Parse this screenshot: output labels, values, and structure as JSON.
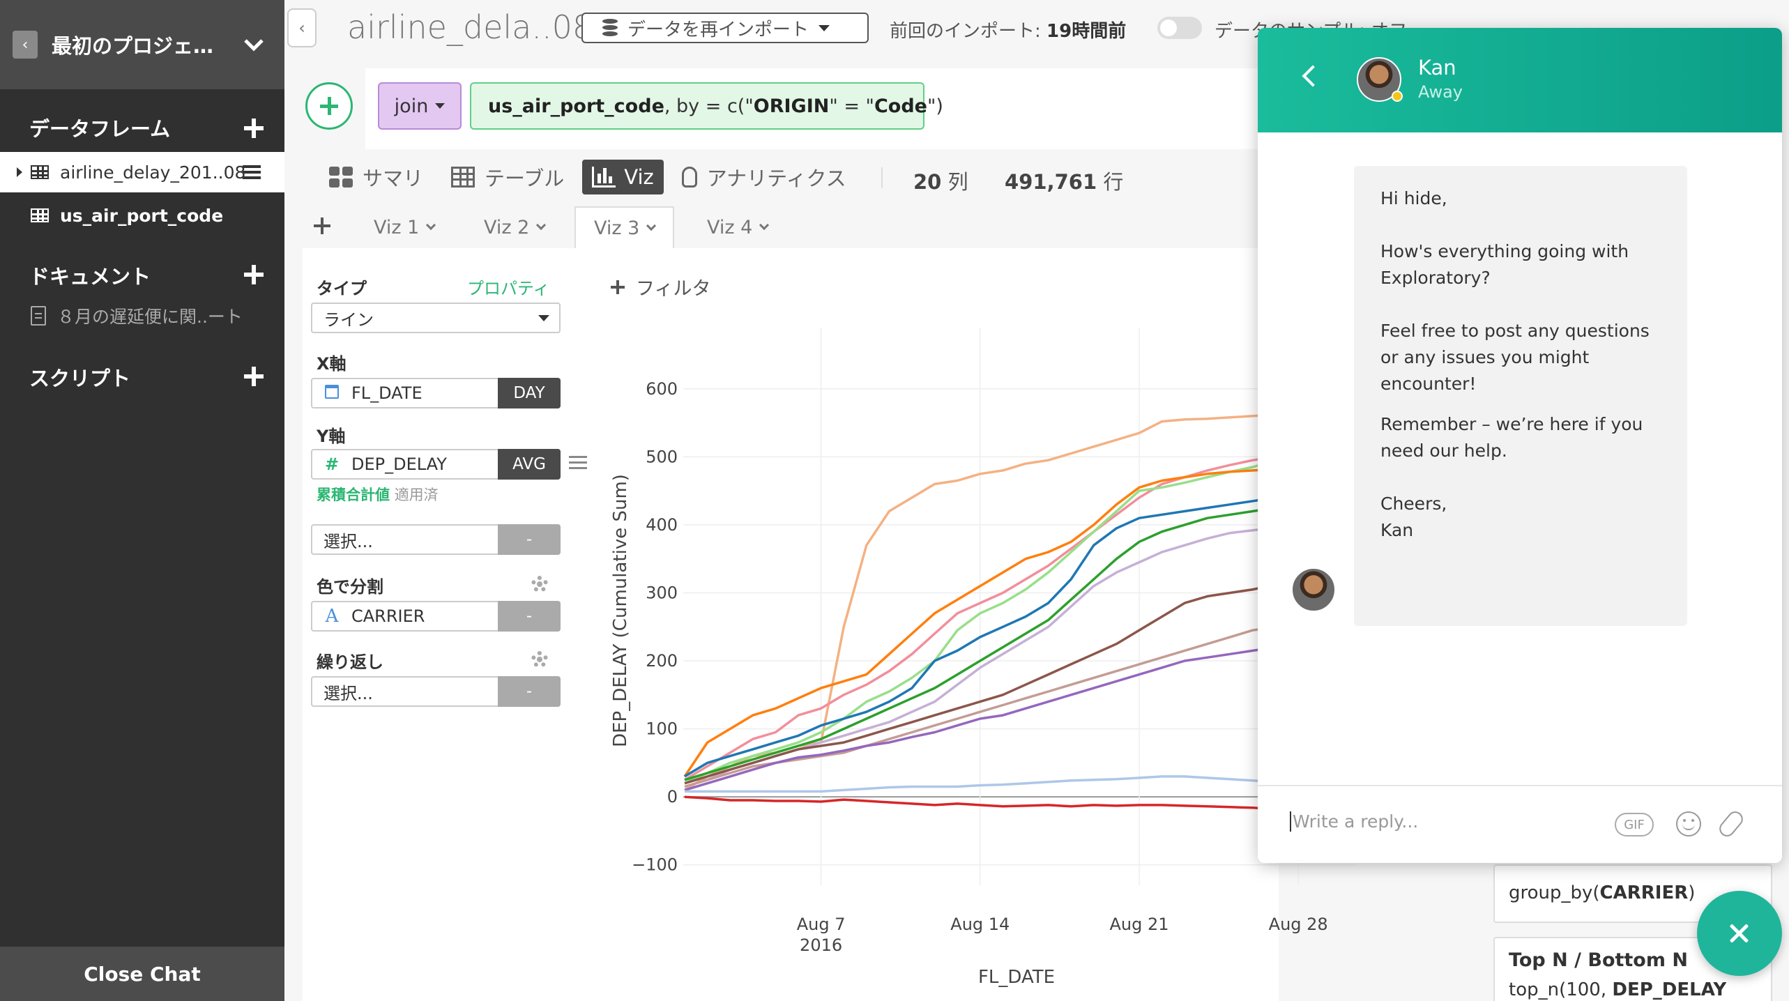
{
  "sidebar": {
    "project_title": "最初のプロジェ…",
    "sections": {
      "dataframes": "データフレーム",
      "documents": "ドキュメント",
      "scripts": "スクリプト"
    },
    "dataframes": [
      "airline_delay_201..08",
      "us_air_port_code"
    ],
    "documents": [
      "８月の遅延便に関..ート"
    ],
    "close_chat": "Close Chat"
  },
  "topbar": {
    "dataframe_name": "airline_dela..08",
    "reimport_label": "データを再インポート",
    "last_import_label": "前回のインポート: ",
    "last_import_value": "19時間前",
    "sample_label": "データのサンプル: オフ"
  },
  "pipeline": {
    "command": "join",
    "args_prefix": "us_air_port_code",
    "args_mid": ", by = c(\"",
    "args_key1": "ORIGIN",
    "args_eq": "\" = \"",
    "args_key2": "Code",
    "args_end": "\")"
  },
  "view_tabs": {
    "summary": "サマリ",
    "table": "テーブル",
    "viz": "Viz",
    "analytics": "アナリティクス"
  },
  "stats": {
    "columns": "20",
    "columns_unit": "列",
    "rows": "491,761",
    "rows_unit": "行"
  },
  "viz_tabs": [
    "Viz 1",
    "Viz 2",
    "Viz 3",
    "Viz 4"
  ],
  "config": {
    "type_label": "タイプ",
    "property_link": "プロパティ",
    "type_value": "ライン",
    "x_label": "X軸",
    "x_field": "FL_DATE",
    "x_agg": "DAY",
    "y_label": "Y軸",
    "y_field": "DEP_DELAY",
    "y_agg": "AVG",
    "cumulative_label": "累積合計値",
    "cumulative_status": "適用済",
    "select_placeholder": "選択...",
    "dash": "-",
    "color_label": "色で分割",
    "color_field": "CARRIER",
    "repeat_label": "繰り返し",
    "repeat_placeholder": "選択...",
    "filter_label": "フィルタ"
  },
  "side_cards": {
    "group_by_prefix": "group_by(",
    "group_by_field": "CARRIER",
    "group_by_suffix": ")",
    "topn_title": "Top N / Bottom N",
    "topn_code_prefix": "top_n(100, ",
    "topn_code_field": "DEP_DELAY"
  },
  "chat": {
    "agent_name": "Kan",
    "agent_status": "Away",
    "messages": [
      "Hi hide,",
      "How's everything going with Exploratory?",
      "Feel free to post any questions or any issues you might encounter!",
      "Remember – we’re here if you need our help.",
      "Cheers,\nKan"
    ],
    "input_placeholder": "Write a reply...",
    "gif_label": "GIF",
    "header_color": "#1abc9c"
  },
  "chart_data": {
    "type": "line",
    "xlabel": "FL_DATE",
    "ylabel": "DEP_DELAY (Cumulative Sum)",
    "x": [
      "2016-08-01",
      "2016-08-02",
      "2016-08-03",
      "2016-08-04",
      "2016-08-05",
      "2016-08-06",
      "2016-08-07",
      "2016-08-08",
      "2016-08-09",
      "2016-08-10",
      "2016-08-11",
      "2016-08-12",
      "2016-08-13",
      "2016-08-14",
      "2016-08-15",
      "2016-08-16",
      "2016-08-17",
      "2016-08-18",
      "2016-08-19",
      "2016-08-20",
      "2016-08-21",
      "2016-08-22",
      "2016-08-23",
      "2016-08-24",
      "2016-08-25",
      "2016-08-26",
      "2016-08-27",
      "2016-08-28"
    ],
    "x_ticks": [
      {
        "date": "2016-08-07",
        "label": "Aug 7",
        "sublabel": "2016"
      },
      {
        "date": "2016-08-14",
        "label": "Aug 14",
        "sublabel": ""
      },
      {
        "date": "2016-08-21",
        "label": "Aug 21",
        "sublabel": ""
      },
      {
        "date": "2016-08-28",
        "label": "Aug 28",
        "sublabel": ""
      }
    ],
    "y_ticks": [
      -100,
      0,
      100,
      200,
      300,
      400,
      500,
      600
    ],
    "y_tick_labels": [
      "−100",
      "0",
      "100",
      "200",
      "300",
      "400",
      "500",
      "600"
    ],
    "ylim": [
      -130,
      690
    ],
    "grid": true,
    "series": [
      {
        "color": "#f4b183",
        "values": [
          10,
          30,
          45,
          60,
          65,
          75,
          80,
          250,
          370,
          420,
          440,
          460,
          465,
          475,
          480,
          490,
          495,
          505,
          515,
          525,
          535,
          552,
          555,
          556,
          558,
          560,
          562,
          565
        ]
      },
      {
        "color": "#f28e9b",
        "values": [
          25,
          45,
          65,
          85,
          95,
          120,
          130,
          150,
          165,
          185,
          210,
          240,
          270,
          285,
          300,
          320,
          340,
          365,
          390,
          415,
          440,
          460,
          470,
          480,
          488,
          495,
          500,
          502
        ]
      },
      {
        "color": "#98df8a",
        "values": [
          20,
          35,
          50,
          60,
          70,
          80,
          95,
          115,
          140,
          155,
          175,
          200,
          245,
          270,
          285,
          305,
          330,
          360,
          390,
          420,
          450,
          455,
          462,
          470,
          478,
          485,
          495,
          505
        ]
      },
      {
        "color": "#ff7f0e",
        "values": [
          30,
          80,
          100,
          120,
          130,
          145,
          160,
          170,
          180,
          210,
          240,
          270,
          290,
          310,
          330,
          350,
          360,
          375,
          400,
          430,
          455,
          465,
          470,
          475,
          478,
          480,
          482,
          482
        ]
      },
      {
        "color": "#1f77b4",
        "values": [
          30,
          50,
          60,
          70,
          80,
          90,
          105,
          115,
          125,
          140,
          160,
          200,
          215,
          235,
          250,
          265,
          285,
          320,
          370,
          395,
          410,
          415,
          420,
          425,
          430,
          435,
          440,
          440
        ]
      },
      {
        "color": "#2ca02c",
        "values": [
          25,
          35,
          45,
          55,
          65,
          75,
          85,
          100,
          115,
          130,
          145,
          160,
          180,
          200,
          220,
          240,
          260,
          290,
          320,
          350,
          375,
          390,
          400,
          410,
          415,
          420,
          425,
          428
        ]
      },
      {
        "color": "#c5b0d5",
        "values": [
          15,
          25,
          40,
          50,
          60,
          70,
          80,
          90,
          100,
          110,
          125,
          140,
          165,
          190,
          210,
          230,
          250,
          280,
          310,
          330,
          345,
          360,
          370,
          380,
          388,
          392,
          396,
          400
        ]
      },
      {
        "color": "#8c564b",
        "values": [
          20,
          30,
          40,
          50,
          60,
          70,
          75,
          80,
          90,
          100,
          110,
          120,
          130,
          140,
          150,
          165,
          180,
          195,
          210,
          225,
          245,
          265,
          285,
          295,
          300,
          305,
          312,
          318
        ]
      },
      {
        "color": "#c49c94",
        "values": [
          15,
          25,
          35,
          45,
          50,
          55,
          60,
          65,
          75,
          85,
          95,
          105,
          115,
          125,
          135,
          145,
          155,
          165,
          175,
          185,
          195,
          205,
          215,
          225,
          235,
          245,
          250,
          255
        ]
      },
      {
        "color": "#9467bd",
        "values": [
          10,
          20,
          30,
          40,
          50,
          58,
          62,
          68,
          75,
          80,
          88,
          95,
          105,
          115,
          120,
          130,
          140,
          150,
          160,
          170,
          180,
          190,
          200,
          205,
          210,
          215,
          220,
          224
        ]
      },
      {
        "color": "#aec7e8",
        "values": [
          8,
          8,
          8,
          8,
          8,
          8,
          8,
          10,
          12,
          14,
          15,
          15,
          15,
          17,
          18,
          20,
          22,
          24,
          25,
          26,
          28,
          30,
          30,
          28,
          26,
          24,
          22,
          18
        ]
      },
      {
        "color": "#d62728",
        "values": [
          0,
          -2,
          -5,
          -5,
          -6,
          -6,
          -7,
          -4,
          -6,
          -8,
          -10,
          -12,
          -10,
          -12,
          -14,
          -13,
          -12,
          -14,
          -12,
          -13,
          -12,
          -12,
          -13,
          -14,
          -15,
          -16,
          -18,
          -22
        ]
      }
    ]
  }
}
